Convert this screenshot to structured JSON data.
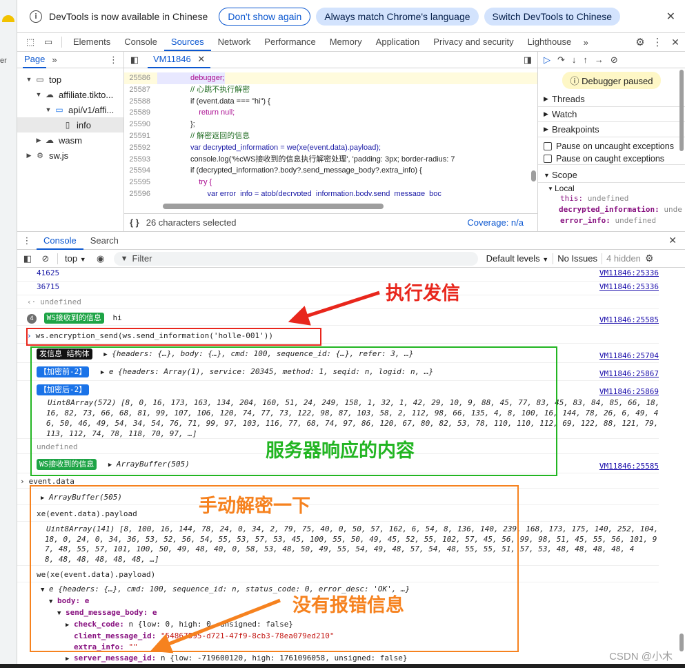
{
  "infobar": {
    "message": "DevTools is now available in Chinese",
    "dont_show": "Don't show again",
    "always_match": "Always match Chrome's language",
    "switch": "Switch DevTools to Chinese"
  },
  "tabs": [
    "Elements",
    "Console",
    "Sources",
    "Network",
    "Performance",
    "Memory",
    "Application",
    "Privacy and security",
    "Lighthouse"
  ],
  "active_tab": "Sources",
  "navigator": {
    "tab": "Page",
    "items": [
      {
        "label": "top"
      },
      {
        "label": "affiliate.tikto..."
      },
      {
        "label": "api/v1/affi..."
      },
      {
        "label": "info"
      },
      {
        "label": "wasm"
      },
      {
        "label": "sw.js"
      }
    ]
  },
  "editor": {
    "file_tab": "VM11846",
    "lines": [
      {
        "n": "25586",
        "t": "debugger;"
      },
      {
        "n": "25587",
        "t": "// 心跳不执行解密"
      },
      {
        "n": "25588",
        "t": "if (event.data === \"hi\") {"
      },
      {
        "n": "25589",
        "t": "    return null;"
      },
      {
        "n": "25590",
        "t": "};"
      },
      {
        "n": "25591",
        "t": "// 解密返回的信息"
      },
      {
        "n": "25592",
        "t": "var decrypted_information = we(xe(event.data).payload);"
      },
      {
        "n": "25593",
        "t": "console.log('%cWS接收到的信息执行解密处理', 'padding: 3px; border-radius: 7"
      },
      {
        "n": "25594",
        "t": "if (decrypted_information?.body?.send_message_body?.extra_info) {"
      },
      {
        "n": "25595",
        "t": "    try {"
      },
      {
        "n": "25596",
        "t": "        var error_info = atob(decrypted_information.body.send_message_boc"
      }
    ],
    "status_selected": "26 characters selected",
    "coverage": "Coverage: n/a"
  },
  "debugger": {
    "paused": "Debugger paused",
    "sections": [
      "Threads",
      "Watch",
      "Breakpoints"
    ],
    "pause_uncaught": "Pause on uncaught exceptions",
    "pause_caught": "Pause on caught exceptions",
    "scope": "Scope",
    "local": "Local",
    "vars": [
      {
        "name": "this:",
        "value": "undefined"
      },
      {
        "name": "decrypted_information:",
        "value": "unde"
      },
      {
        "name": "error_info:",
        "value": "undefined"
      }
    ]
  },
  "drawer": {
    "tabs": [
      "Console",
      "Search"
    ]
  },
  "console_toolbar": {
    "context": "top",
    "filter": "Filter",
    "levels": "Default levels",
    "issues": "No Issues",
    "hidden": "4 hidden"
  },
  "console": {
    "r1": "41625",
    "r1src": "VM11846:25336",
    "r2": "36715",
    "r2src": "VM11846:25336",
    "r3": "undefined",
    "r4count": "4",
    "r4badge": "WS接收到的信息",
    "r4text": "hi",
    "r4src": "VM11846:25585",
    "r5": "ws.encryption_send(ws.send_information('holle-001'))",
    "r6badge": "发信息 结构体",
    "r6text": "{headers: {…}, body: {…}, cmd: 100, sequence_id: {…}, refer: 3, …}",
    "r6src": "VM11846:25704",
    "r7badge": "【加密前-2】",
    "r7text": "e {headers: Array(1), service: 20345, method: 1, seqid: n, logid: n, …}",
    "r7src": "VM11846:25867",
    "r8badge": "【加密后-2】",
    "r8src": "VM11846:25869",
    "r8a": "Uint8Array(572) [8, 0, 16, 173, 163, 134, 204, 160, 51, 24, 249, 158, 1, 32, 1, 42, 29, 10, 9, 88, 45, 77, 83, 45, 83, 84, 85, 66, 18,",
    "r8b": "16, 82, 73, 66, 68, 81, 99, 107, 106, 120, 74, 77, 73, 122, 98, 87, 103, 58, 2, 112, 98, 66, 135, 4, 8, 100, 16, 144, 78, 26, 6, 49, 4",
    "r8c": "6, 50, 46, 49, 54, 34, 54, 76, 71, 99, 97, 103, 116, 77, 68, 74, 97, 86, 120, 67, 80, 82, 53, 78, 110, 110, 112, 69, 122, 88, 121, 79,",
    "r8d": "113, 112, 74, 78, 118, 70, 97, …]",
    "r9": "undefined",
    "r10badge": "WS接收到的信息",
    "r10text": "ArrayBuffer(505)",
    "r10src": "VM11846:25585",
    "r11": "event.data",
    "r12": "ArrayBuffer(505)",
    "r13": "xe(event.data).payload",
    "r14a": "Uint8Array(141) [8, 100, 16, 144, 78, 24, 0, 34, 2, 79, 75, 40, 0, 50, 57, 162, 6, 54, 8, 136, 140, 239, 168, 173, 175, 140, 252, 104,",
    "r14b": "18, 0, 24, 0, 34, 36, 53, 52, 56, 54, 55, 53, 57, 53, 45, 100, 55, 50, 49, 45, 52, 55, 102, 57, 45, 56, 99, 98, 51, 45, 55, 56, 101, 9",
    "r14c": "7, 48, 55, 57, 101, 100, 50, 49, 48, 40, 0, 58, 53, 48, 50, 49, 55, 54, 49, 48, 57, 54, 48, 55, 55, 51, 57, 53, 48, 48, 48, 48, 4",
    "r14d": "8, 48, 48, 48, 48, 48, …]",
    "r15": "we(xe(event.data).payload)",
    "r16": "e {headers: {…}, cmd: 100, sequence_id: n, status_code: 0, error_desc: 'OK', …}",
    "r17": "body: e",
    "r18": "send_message_body: e",
    "r19k": "check_code:",
    "r19v": "n {low: 0, high: 0, unsigned: false}",
    "r20k": "client_message_id:",
    "r20v": "\"54867595-d721-47f9-8cb3-78ea079ed210\"",
    "r21k": "extra_info:",
    "r21v": "\"\"",
    "r22k": "server_message_id:",
    "r22v": "n {low: -719600120, high: 1761096058, unsigned: false}"
  },
  "annotations": {
    "exec": "执行发信",
    "server": "服务器响应的内容",
    "manual": "手动解密一下",
    "noerr": "没有报错信息",
    "red": "#e8261c",
    "green": "#22b522",
    "orange": "#f6821f"
  },
  "watermark": "CSDN @小木"
}
